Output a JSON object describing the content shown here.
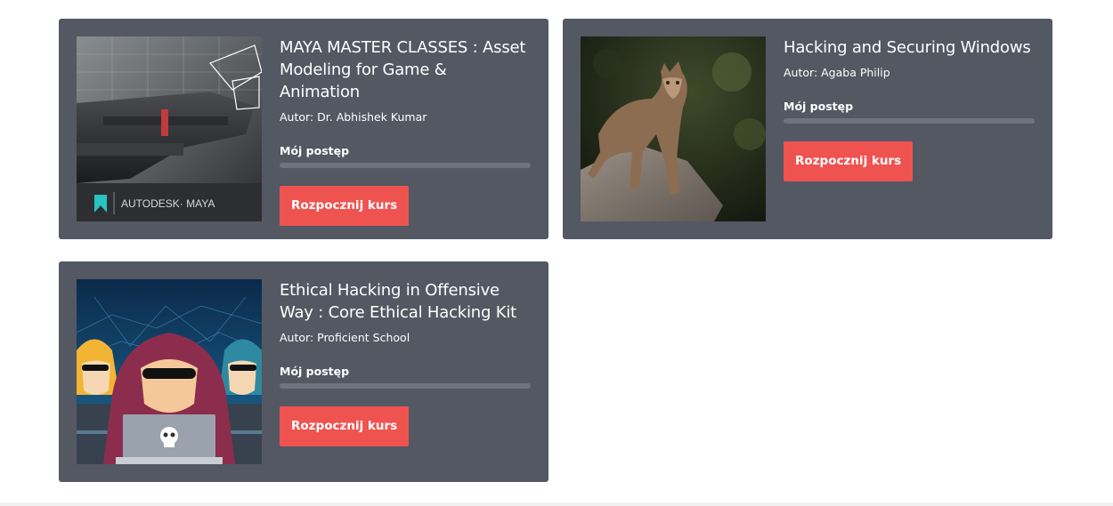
{
  "courses": [
    {
      "title": "MAYA MASTER CLASSES : Asset Modeling for Game & Animation",
      "author": "Autor: Dr. Abhishek Kumar",
      "progress_label": "Mój postęp",
      "progress": 0,
      "button_label": "Rozpocznij kurs",
      "thumb_logo_text": "AUTODESK· MAYA"
    },
    {
      "title": "Hacking and Securing Windows",
      "author": "Autor: Agaba Philip",
      "progress_label": "Mój postęp",
      "progress": 0,
      "button_label": "Rozpocznij kurs"
    },
    {
      "title": "Ethical Hacking in Offensive Way : Core Ethical Hacking Kit",
      "author": "Autor: Proficient School",
      "progress_label": "Mój postęp",
      "progress": 0,
      "button_label": "Rozpocznij kurs"
    }
  ],
  "colors": {
    "card_bg": "#535863",
    "button_bg": "#ef5350",
    "progress_track": "#6e737d"
  }
}
